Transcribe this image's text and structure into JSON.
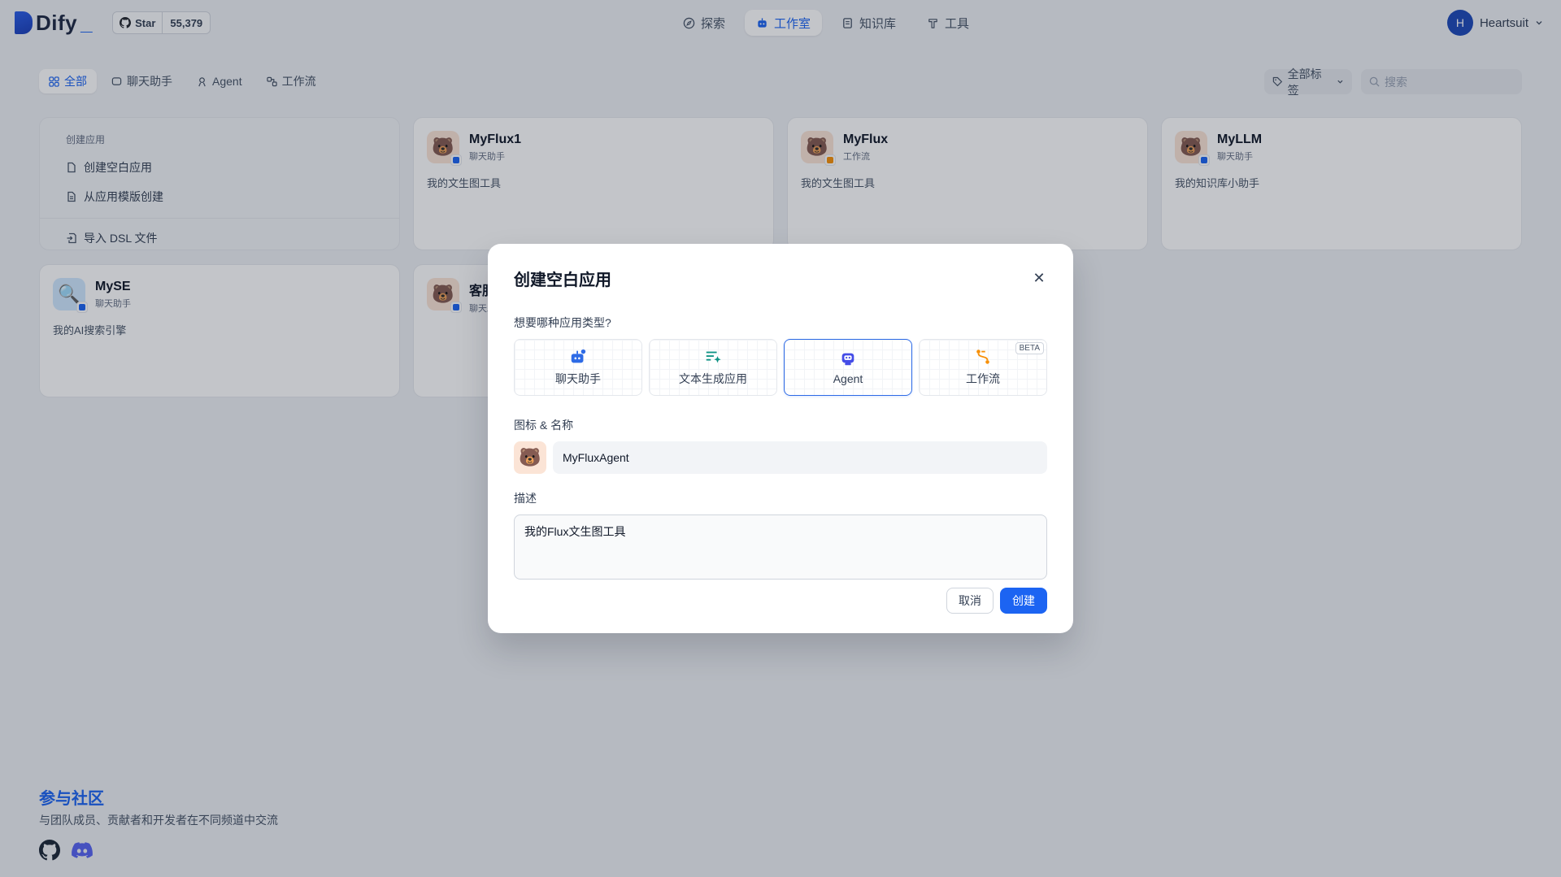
{
  "app": {
    "brand": "Dify",
    "brand_suffix": "_",
    "accent": "#1c64f2"
  },
  "github": {
    "star_label": "Star",
    "star_count": "55,379"
  },
  "nav": {
    "explore": "探索",
    "studio": "工作室",
    "knowledge": "知识库",
    "tools": "工具"
  },
  "user": {
    "initial": "H",
    "name": "Heartsuit"
  },
  "filters": {
    "all": "全部",
    "chat": "聊天助手",
    "agent": "Agent",
    "workflow": "工作流"
  },
  "toolbar": {
    "tag_select": "全部标签",
    "search_placeholder": "搜索"
  },
  "create_card": {
    "title": "创建应用",
    "blank": "创建空白应用",
    "template": "从应用模版创建",
    "import_dsl": "导入 DSL 文件"
  },
  "apps": [
    {
      "name": "MyFlux1",
      "type": "聊天助手",
      "desc": "我的文生图工具"
    },
    {
      "name": "MyFlux",
      "type": "工作流",
      "desc": "我的文生图工具"
    },
    {
      "name": "MyLLM",
      "type": "聊天助手",
      "desc": "我的知识库小助手"
    },
    {
      "name": "MySE",
      "type": "聊天助手",
      "desc": "我的AI搜索引擎"
    },
    {
      "name": "客服",
      "type": "聊天助手",
      "desc": ""
    }
  ],
  "community": {
    "title": "参与社区",
    "subtitle": "与团队成员、贡献者和开发者在不同频道中交流"
  },
  "modal": {
    "title": "创建空白应用",
    "type_question": "想要哪种应用类型?",
    "types": [
      {
        "label": "聊天助手",
        "icon": "chat-bot-icon"
      },
      {
        "label": "文本生成应用",
        "icon": "text-generation-icon"
      },
      {
        "label": "Agent",
        "icon": "agent-robot-icon",
        "selected": true
      },
      {
        "label": "工作流",
        "icon": "workflow-icon",
        "badge": "BETA"
      }
    ],
    "icon_name_label": "图标 & 名称",
    "name_value": "MyFluxAgent",
    "description_label": "描述",
    "description_value": "我的Flux文生图工具",
    "cancel": "取消",
    "create": "创建"
  }
}
